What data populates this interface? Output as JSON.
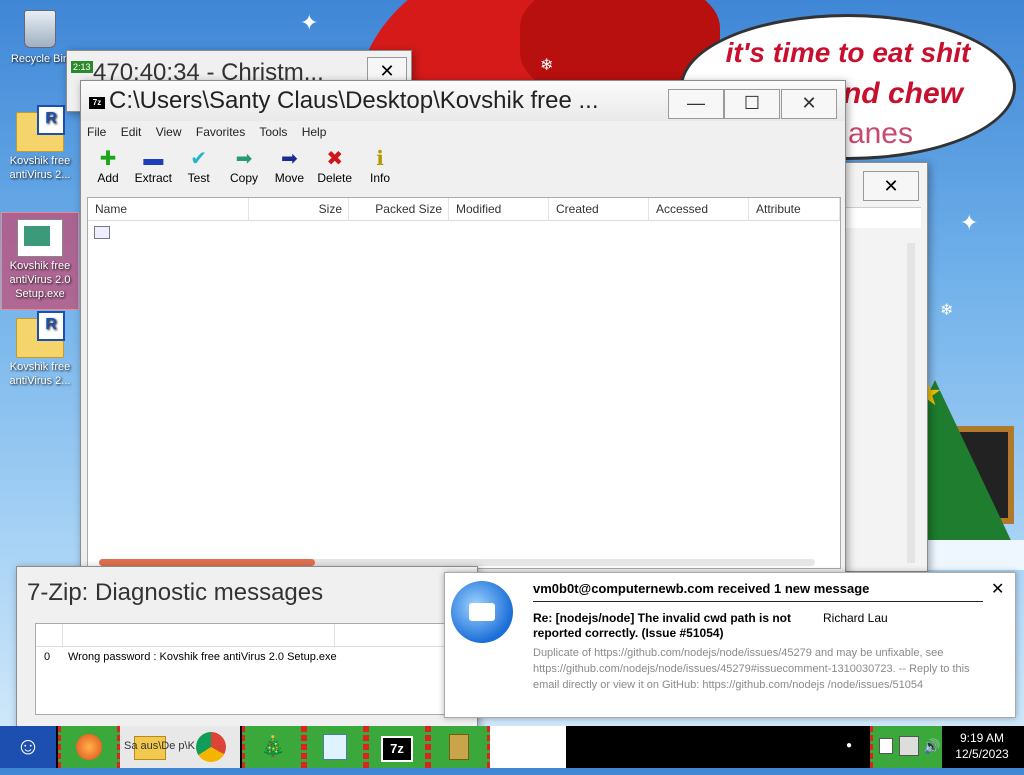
{
  "wallpaper": {
    "bubble_lines": [
      "it's time to eat shit",
      "and chew",
      "anes"
    ]
  },
  "desktop_icons": [
    {
      "label": "Recycle Bin",
      "icon": "recycle-bin-icon"
    },
    {
      "label": "Kovshik free antiVirus 2...",
      "icon": "winrar-archive-icon"
    },
    {
      "label": "Kovshik free antiVirus 2.0 Setup.exe",
      "icon": "setup-exe-icon"
    },
    {
      "label": "Kovshik free antiVirus 2...",
      "icon": "winrar-archive-icon"
    }
  ],
  "back_window": {
    "badge": "2:13",
    "title": "470:40:34 - Christm...",
    "close": "✕"
  },
  "main_window": {
    "title": "C:\\Users\\Santy Claus\\Desktop\\Kovshik free ...",
    "minimize": "—",
    "maximize": "☐",
    "close": "✕",
    "menu": [
      "File",
      "Edit",
      "View",
      "Favorites",
      "Tools",
      "Help"
    ],
    "toolbar": [
      {
        "label": "Add",
        "icon": "add-icon",
        "glyph": "✚",
        "color": "#1aa81a"
      },
      {
        "label": "Extract",
        "icon": "extract-icon",
        "glyph": "▬",
        "color": "#1b3fb8"
      },
      {
        "label": "Test",
        "icon": "test-icon",
        "glyph": "✔",
        "color": "#20b7c9"
      },
      {
        "label": "Copy",
        "icon": "copy-icon",
        "glyph": "➡",
        "color": "#2a9a70"
      },
      {
        "label": "Move",
        "icon": "move-icon",
        "glyph": "➡",
        "color": "#1b2a90"
      },
      {
        "label": "Delete",
        "icon": "delete-icon",
        "glyph": "✖",
        "color": "#d0161a"
      },
      {
        "label": "Info",
        "icon": "info-icon",
        "glyph": "ℹ",
        "color": "#b49a00"
      }
    ],
    "columns": [
      "Name",
      "Size",
      "Packed Size",
      "Modified",
      "Created",
      "Accessed",
      "Attribute"
    ]
  },
  "side_window": {
    "close": "✕"
  },
  "diagnostic_window": {
    "title": "7-Zip: Diagnostic messages",
    "rows": [
      {
        "index": "0",
        "message": "Wrong password : Kovshik free antiVirus 2.0 Setup.exe"
      }
    ]
  },
  "notification": {
    "header": "vm0b0t@computernewb.com received 1 new message",
    "close": "✕",
    "subject": "Re: [nodejs/node] The invalid cwd path is not reported correctly. (Issue #51054)",
    "sender": "Richard Lau",
    "body": "Duplicate of https://github.com/nodejs/node/issues/45279 and may be unfixable, see https://github.com/nodejs/node/issues/45279#issuecomment-1310030723. -- Reply to this email directly or view it on GitHub: https://github.com/nodejs /node/issues/51054"
  },
  "taskbar": {
    "items": [
      "firefox-icon",
      "file-explorer-icon",
      "chrome-icon",
      "christmas-tree-icon",
      "notepad-icon",
      "7zip-icon",
      "archive-icon"
    ],
    "ghost_text": "Sa    aus\\De   p\\K",
    "seven_z": "7z",
    "dot": "●",
    "time": "9:19 AM",
    "date": "12/5/2023"
  }
}
